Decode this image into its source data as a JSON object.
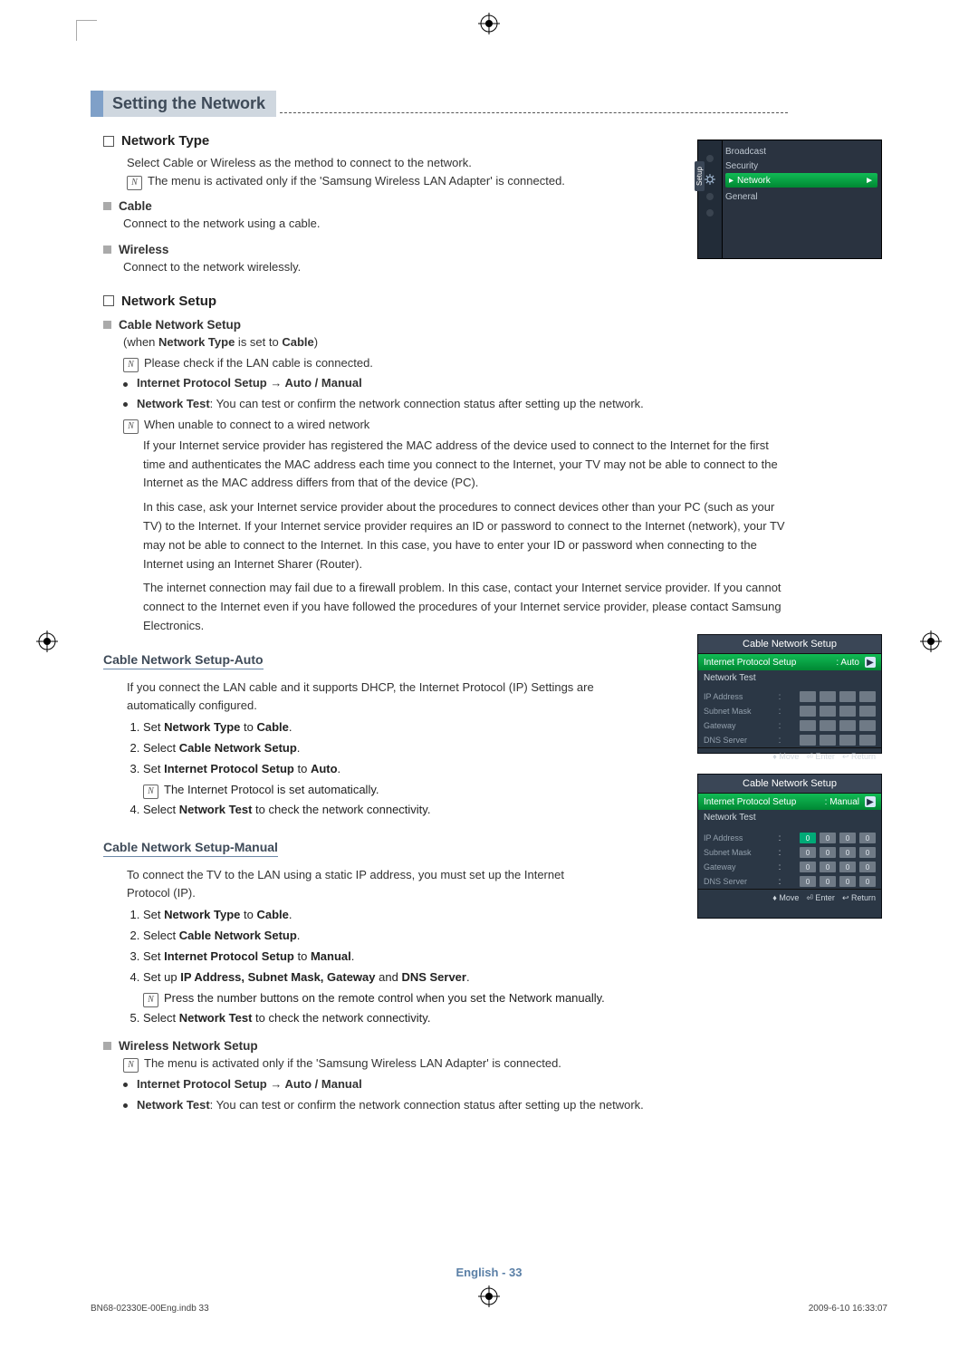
{
  "section_title": "Setting the Network",
  "network_type": {
    "heading": "Network Type",
    "desc": "Select Cable or Wireless as the method to connect to the network.",
    "note": "The menu is activated only if the 'Samsung Wireless LAN Adapter' is connected.",
    "cable": {
      "heading": "Cable",
      "body": "Connect to the network using a cable."
    },
    "wireless": {
      "heading": "Wireless",
      "body": "Connect to the network wirelessly."
    }
  },
  "network_setup": {
    "heading": "Network Setup",
    "cable_ns": {
      "heading": "Cable Network Setup",
      "when_a": "(when ",
      "when_b": "Network Type",
      "when_c": " is set to ",
      "when_d": "Cable",
      "when_e": ")",
      "note1": "Please check if the LAN cable is connected.",
      "ips": "Internet Protocol Setup → Auto / Manual",
      "nt_a": "Network Test",
      "nt_b": ": You can test or confirm the network connection status after setting up the network.",
      "note2": "When unable to connect to a wired network",
      "para1": "If your Internet service provider has registered the MAC address of the device used to connect to the Internet for the first time and authenticates the MAC address each time you connect to the Internet, your TV may not be able to connect to the Internet as the MAC address differs from that of the device (PC).",
      "para2": "In this case, ask your Internet service provider about the procedures to connect devices other than your PC (such as your TV) to the Internet. If your Internet service provider requires an ID or password to connect to the Internet (network), your TV may not be able to connect to the Internet. In this case, you have to enter your ID or password when connecting to the Internet using an Internet Sharer (Router).",
      "para3": "The internet connection may fail due to a firewall problem. In this case, contact your Internet service provider. If you cannot connect to the Internet even if you have followed the procedures of your Internet service provider, please contact Samsung Electronics."
    }
  },
  "auto": {
    "heading": "Cable Network Setup-Auto",
    "intro": "If you connect the LAN cable and it supports DHCP, the Internet Protocol (IP) Settings are automatically configured.",
    "s1a": "Set ",
    "s1b": "Network Type",
    "s1c": " to ",
    "s1d": "Cable",
    "s1e": ".",
    "s2a": "Select ",
    "s2b": "Cable Network Setup",
    "s2c": ".",
    "s3a": "Set ",
    "s3b": "Internet Protocol Setup",
    "s3c": " to ",
    "s3d": "Auto",
    "s3e": ".",
    "s3note": "The Internet Protocol is set automatically.",
    "s4a": "Select ",
    "s4b": "Network Test",
    "s4c": " to check the network connectivity."
  },
  "manual": {
    "heading": "Cable Network Setup-Manual",
    "intro": "To connect the TV to the LAN using a static IP address, you must set up the Internet Protocol (IP).",
    "s1a": "Set ",
    "s1b": "Network Type",
    "s1c": " to ",
    "s1d": "Cable",
    "s1e": ".",
    "s2a": "Select ",
    "s2b": "Cable Network Setup",
    "s2c": ".",
    "s3a": "Set ",
    "s3b": "Internet Protocol Setup",
    "s3c": " to ",
    "s3d": "Manual",
    "s3e": ".",
    "s4a": "Set up ",
    "s4b": "IP Address, Subnet Mask, Gateway",
    "s4c": " and ",
    "s4d": "DNS Server",
    "s4e": ".",
    "s4note": "Press the number buttons on the remote control when you set the Network manually.",
    "s5a": "Select ",
    "s5b": "Network Test",
    "s5c": " to check the network connectivity."
  },
  "wireless_ns": {
    "heading": "Wireless Network Setup",
    "note": "The menu is activated only if the 'Samsung Wireless LAN Adapter' is connected.",
    "ips": "Internet Protocol Setup → Auto / Manual",
    "nt_a": "Network Test",
    "nt_b": ": You can test or confirm the network connection status after setting up the network."
  },
  "osd_side": {
    "broadcast": "Broadcast",
    "security": "Security",
    "network": "Network",
    "general": "General",
    "vtab": "Setup",
    "arrow": "►"
  },
  "osd2": {
    "title": "Cable Network Setup",
    "ips_k": "Internet Protocol Setup",
    "ips_v": ": Auto",
    "nt": "Network Test",
    "ip": "IP Address",
    "sm": "Subnet Mask",
    "gw": "Gateway",
    "dns": "DNS Server",
    "move": "Move",
    "enter": "Enter",
    "return": "Return"
  },
  "osd3": {
    "title": "Cable Network Setup",
    "ips_k": "Internet Protocol Setup",
    "ips_v": ": Manual",
    "nt": "Network Test",
    "ip": "IP Address",
    "sm": "Subnet Mask",
    "gw": "Gateway",
    "dns": "DNS Server",
    "vals": {
      "ip": [
        "0",
        "0",
        "0",
        "0"
      ],
      "sm": [
        "0",
        "0",
        "0",
        "0"
      ],
      "gw": [
        "0",
        "0",
        "0",
        "0"
      ],
      "dns": [
        "0",
        "0",
        "0",
        "0"
      ]
    },
    "move": "Move",
    "enter": "Enter",
    "return": "Return"
  },
  "footer": {
    "lang": "English - ",
    "page": "33",
    "left": "BN68-02330E-00Eng.indb   33",
    "right": "2009-6-10   16:33:07"
  }
}
